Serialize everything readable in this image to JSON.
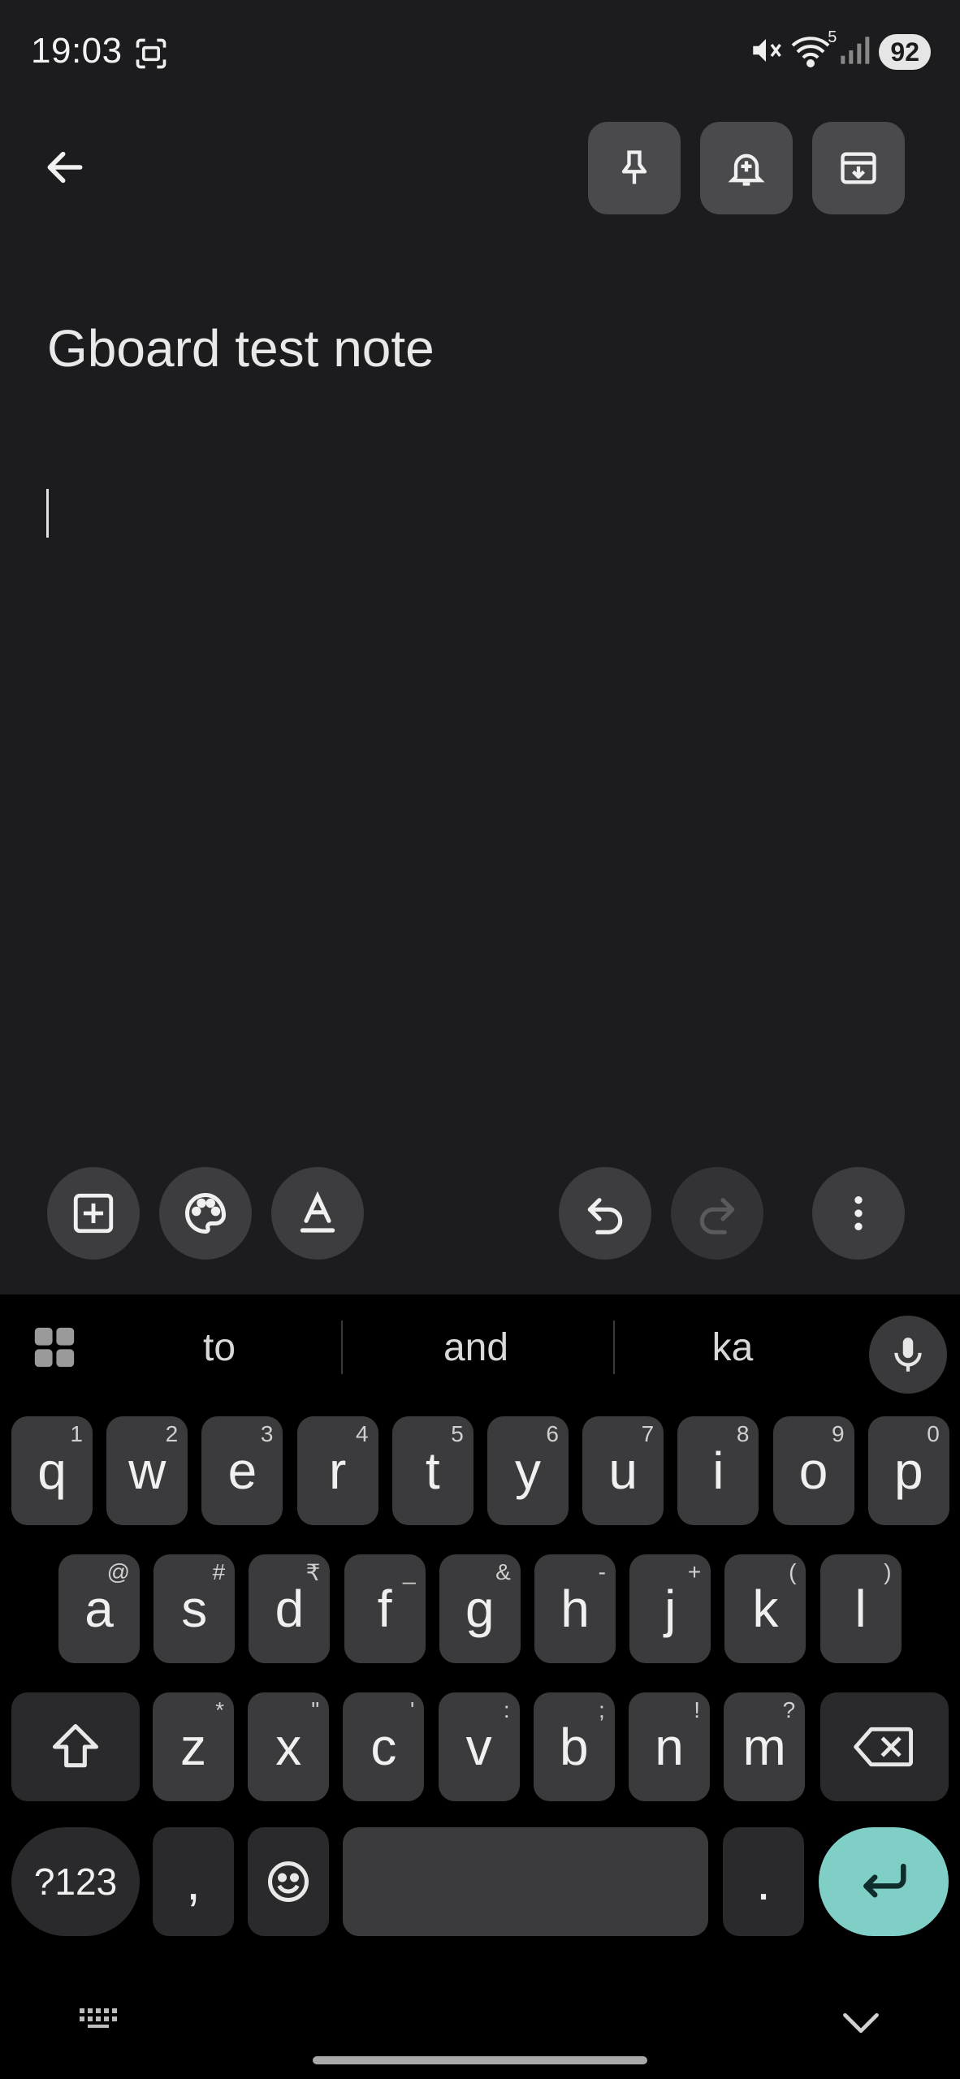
{
  "status_bar": {
    "time": "19:03",
    "battery": "92",
    "wifi_badge": "5"
  },
  "icons": {
    "back": "arrow-left-icon",
    "pin": "pin-icon",
    "reminder": "bell-plus-icon",
    "archive": "archive-icon",
    "add": "add-box-icon",
    "palette": "palette-icon",
    "text_format": "text-format-icon",
    "undo": "undo-icon",
    "redo": "redo-icon",
    "more": "more-vert-icon",
    "grid": "grid-icon",
    "mic": "mic-icon",
    "shift": "shift-icon",
    "backspace": "backspace-icon",
    "emoji": "emoji-icon",
    "enter": "enter-icon",
    "keyboard": "keyboard-icon",
    "chevron": "chevron-down-icon"
  },
  "note": {
    "title": "Gboard test note",
    "body": ""
  },
  "keyboard": {
    "suggestions": [
      "to",
      "and",
      "ka"
    ],
    "row1": [
      {
        "k": "q",
        "h": "1"
      },
      {
        "k": "w",
        "h": "2"
      },
      {
        "k": "e",
        "h": "3"
      },
      {
        "k": "r",
        "h": "4"
      },
      {
        "k": "t",
        "h": "5"
      },
      {
        "k": "y",
        "h": "6"
      },
      {
        "k": "u",
        "h": "7"
      },
      {
        "k": "i",
        "h": "8"
      },
      {
        "k": "o",
        "h": "9"
      },
      {
        "k": "p",
        "h": "0"
      }
    ],
    "row2": [
      {
        "k": "a",
        "h": "@"
      },
      {
        "k": "s",
        "h": "#"
      },
      {
        "k": "d",
        "h": "₹"
      },
      {
        "k": "f",
        "h": "_"
      },
      {
        "k": "g",
        "h": "&"
      },
      {
        "k": "h",
        "h": "-"
      },
      {
        "k": "j",
        "h": "+"
      },
      {
        "k": "k",
        "h": "("
      },
      {
        "k": "l",
        "h": ")"
      }
    ],
    "row3": [
      {
        "k": "z",
        "h": "*"
      },
      {
        "k": "x",
        "h": "\""
      },
      {
        "k": "c",
        "h": "'"
      },
      {
        "k": "v",
        "h": ":"
      },
      {
        "k": "b",
        "h": ";"
      },
      {
        "k": "n",
        "h": "!"
      },
      {
        "k": "m",
        "h": "?"
      }
    ],
    "symbols_label": "?123",
    "comma": ",",
    "period": "."
  },
  "colors": {
    "background": "#1c1c1e",
    "enter_key": "#7fcfc6",
    "key": "#3b3b3d"
  }
}
